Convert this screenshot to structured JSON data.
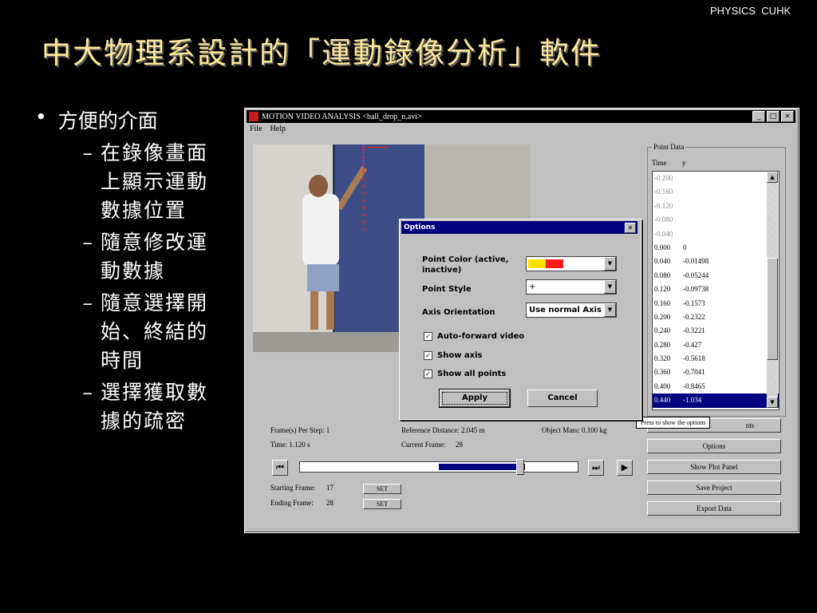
{
  "brand": "PHYSICS  CUHK",
  "slide_title": "中大物理系設計的「運動錄像分析」軟件",
  "bullet_main": "方便的介面",
  "bullet_marker": "•",
  "sub_marker": "–",
  "sub_bullets": [
    "在錄像畫面上顯示運動數據位置",
    "隨意修改運動數據",
    "隨意選擇開始、終結的時間",
    "選擇獲取數據的疏密"
  ],
  "window": {
    "title": "MOTION VIDEO ANALYSIS <ball_drop_n.avi>",
    "menu": [
      "File",
      "Help"
    ],
    "buttons": [
      "_",
      "□",
      "×"
    ]
  },
  "info": {
    "frames_per_step": "Frame(s) Per Step:  1",
    "time": "Time:  1.120 s",
    "reference_distance": "Reference Distance:  2.045 m",
    "current_frame_label": "Current Frame:",
    "current_frame": "28",
    "object_mass": "Object Mass:  0.100 kg",
    "starting_frame_label": "Starting Frame:",
    "starting_frame": "17",
    "ending_frame_label": "Ending Frame:",
    "ending_frame": "28",
    "set_label": "SET"
  },
  "nav": {
    "first": "⏮",
    "last": "⏭",
    "play": "▶"
  },
  "slider_position": 0.79,
  "point_data": {
    "group_label": "Point Data",
    "col_time": "Time",
    "col_y": "y",
    "rows": [
      [
        "-0.200",
        ""
      ],
      [
        "-0.160",
        ""
      ],
      [
        "-0.120",
        ""
      ],
      [
        "-0.080",
        ""
      ],
      [
        "-0.040",
        ""
      ],
      [
        "0.000",
        "0"
      ],
      [
        "0.040",
        "-0.01498"
      ],
      [
        "0.080",
        "-0.05244"
      ],
      [
        "0.120",
        "-0.09738"
      ],
      [
        "0.160",
        "-0.1573"
      ],
      [
        "0.200",
        "-0.2322"
      ],
      [
        "0.240",
        "-0.3221"
      ],
      [
        "0.280",
        "-0.427"
      ],
      [
        "0.320",
        "-0.5618"
      ],
      [
        "0.360",
        "-0.7041"
      ],
      [
        "0.400",
        "-0.8465"
      ],
      [
        "0.440",
        "-1.034"
      ]
    ],
    "selected_index": 16
  },
  "right_buttons": {
    "points": "nts",
    "options": "Options",
    "show_plot": "Show Plot Panel",
    "save_project": "Save Project",
    "export_data": "Export Data"
  },
  "tooltip": "Press to show the options",
  "options_dialog": {
    "title": "Options",
    "point_color_label": "Point Color (active, inactive)",
    "point_color_active": "#ffe000",
    "point_color_inactive": "#ff1a1a",
    "point_style_label": "Point Style",
    "point_style_value": "+",
    "axis_orientation_label": "Axis Orientation",
    "axis_orientation_value": "Use normal Axis",
    "auto_forward_label": "Auto-forward video",
    "show_axis_label": "Show axis",
    "show_all_points_label": "Show all points",
    "check_mark": "✓",
    "apply_label": "Apply",
    "cancel_label": "Cancel"
  }
}
